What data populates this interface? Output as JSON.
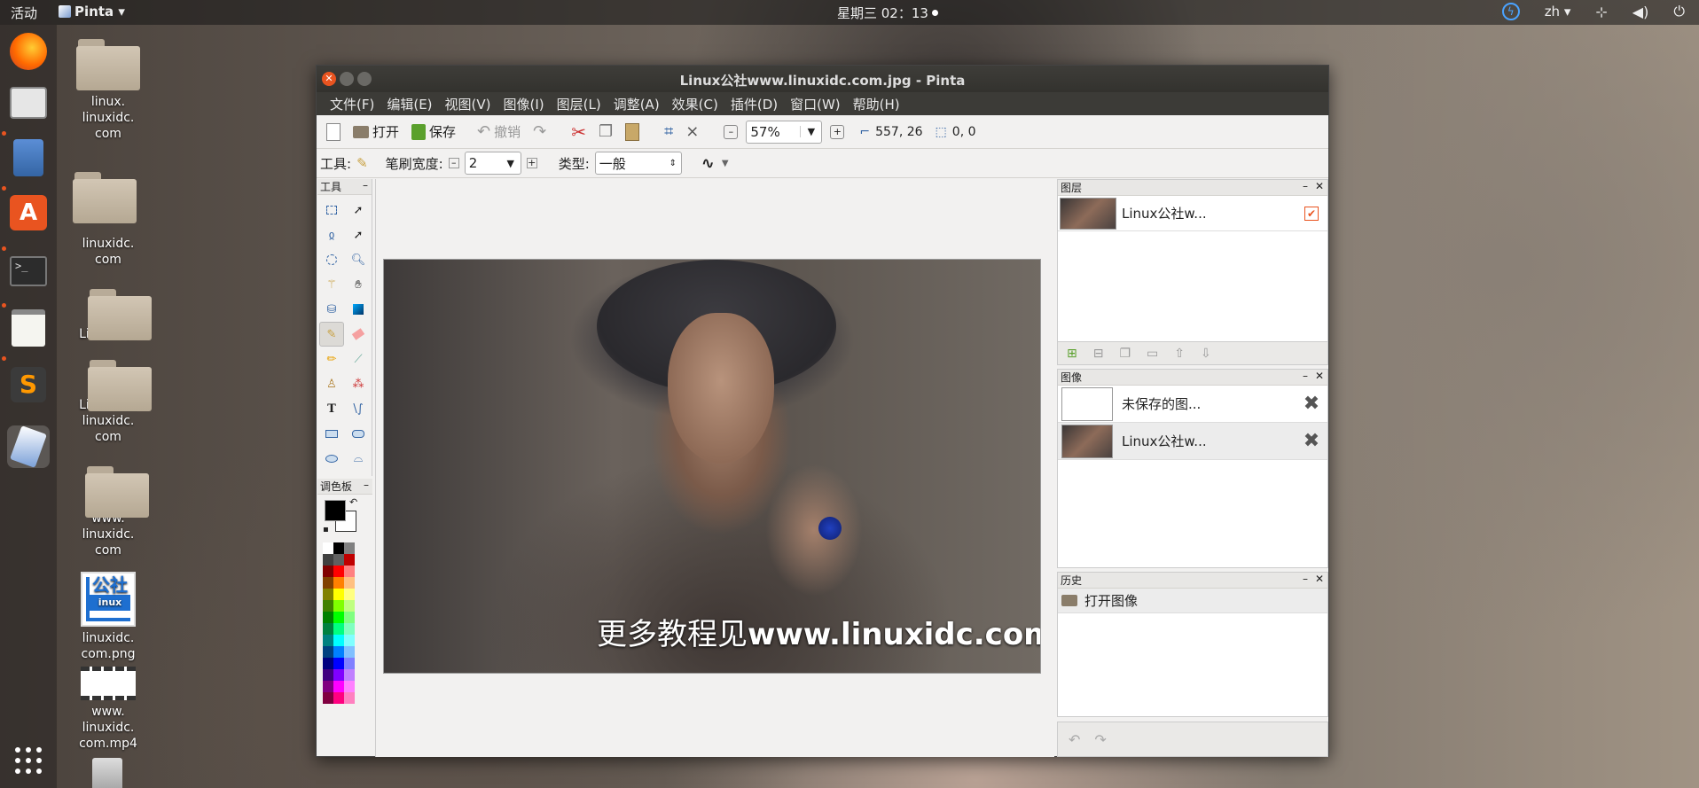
{
  "topbar": {
    "activities": "活动",
    "app_name": "Pinta",
    "app_arrow": "▾",
    "clock": "星期三 02：13",
    "lang": "zh",
    "lang_arrow": "▾"
  },
  "desktop_icons": [
    {
      "label": "linux.\nlinuxidc.\ncom"
    },
    {
      "label": "linuxidc.\ncom"
    },
    {
      "label": "Linux公社"
    },
    {
      "label": "Linux公社\nlinuxidc.\ncom"
    },
    {
      "label": "www.\nlinuxidc.\ncom"
    },
    {
      "label": "linuxidc.\ncom.png"
    },
    {
      "label": "www.\nlinuxidc.\ncom.mp4"
    }
  ],
  "logo_text": {
    "top": "公社",
    "bottom": "inux"
  },
  "window": {
    "title": "Linux公社www.linuxidc.com.jpg - Pinta"
  },
  "menu": [
    "文件(F)",
    "编辑(E)",
    "视图(V)",
    "图像(I)",
    "图层(L)",
    "调整(A)",
    "效果(C)",
    "插件(D)",
    "窗口(W)",
    "帮助(H)"
  ],
  "toolbar": {
    "open": "打开",
    "save": "保存",
    "undo": "撤销",
    "zoom_value": "57%",
    "cursor_pos": "557, 26",
    "selection_size": "0, 0"
  },
  "toolbar2": {
    "tool_label": "工具:",
    "brush_width_label": "笔刷宽度:",
    "brush_width": "2",
    "type_label": "类型:",
    "type_value": "一般"
  },
  "panels": {
    "tools_title": "工具",
    "palette_title": "调色板",
    "layers_title": "图层",
    "images_title": "图像",
    "history_title": "历史",
    "minimize": "–",
    "close": "✕"
  },
  "layers": [
    {
      "name": "Linux公社w...",
      "visible": true
    }
  ],
  "images": [
    {
      "name": "未保存的图..."
    },
    {
      "name": "Linux公社w..."
    }
  ],
  "history": [
    {
      "name": "打开图像"
    }
  ],
  "photo": {
    "watermark_cn": "更多教程见",
    "watermark_url": "www.linuxidc.com"
  },
  "palette_colors": [
    "#ffffff",
    "#000000",
    "#808080",
    "#404040",
    "#606060",
    "#c00000",
    "#800000",
    "#ff0000",
    "#ff8080",
    "#804000",
    "#ff8000",
    "#ffc080",
    "#808000",
    "#ffff00",
    "#ffff80",
    "#408000",
    "#80ff00",
    "#c0ff80",
    "#008000",
    "#00ff00",
    "#80ff80",
    "#008040",
    "#00ff80",
    "#80ffc0",
    "#008080",
    "#00ffff",
    "#80ffff",
    "#004080",
    "#0080ff",
    "#80c0ff",
    "#000080",
    "#0000ff",
    "#8080ff",
    "#400080",
    "#8000ff",
    "#c080ff",
    "#800080",
    "#ff00ff",
    "#ff80ff",
    "#800040",
    "#ff0080",
    "#ff80c0"
  ]
}
